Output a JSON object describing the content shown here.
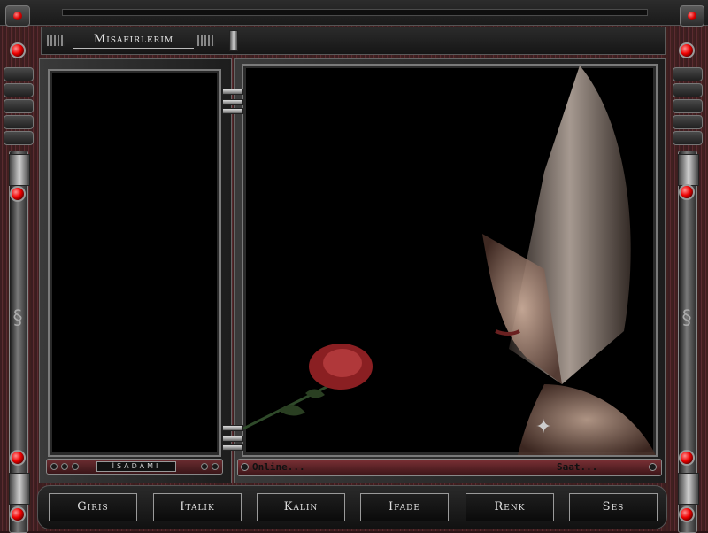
{
  "window": {
    "title": "Misafirlerim"
  },
  "left_panel": {
    "status_label": "İSADAMI"
  },
  "right_panel": {
    "online_label": "Online...",
    "clock_label": "Saat..."
  },
  "toolbar": {
    "buttons": [
      {
        "label": "Giris"
      },
      {
        "label": "Italik"
      },
      {
        "label": "Kalin"
      },
      {
        "label": "Ifade"
      },
      {
        "label": "Renk"
      },
      {
        "label": "Ses"
      }
    ]
  },
  "colors": {
    "accent_red": "#dd0000",
    "frame_maroon": "#5a2b30",
    "panel_bg": "#000000",
    "chrome": "#9a9a9a"
  },
  "icons": {
    "led": "red-led-icon",
    "ornament": "scroll-ornament-icon",
    "emblem": "winged-emblem-icon"
  }
}
